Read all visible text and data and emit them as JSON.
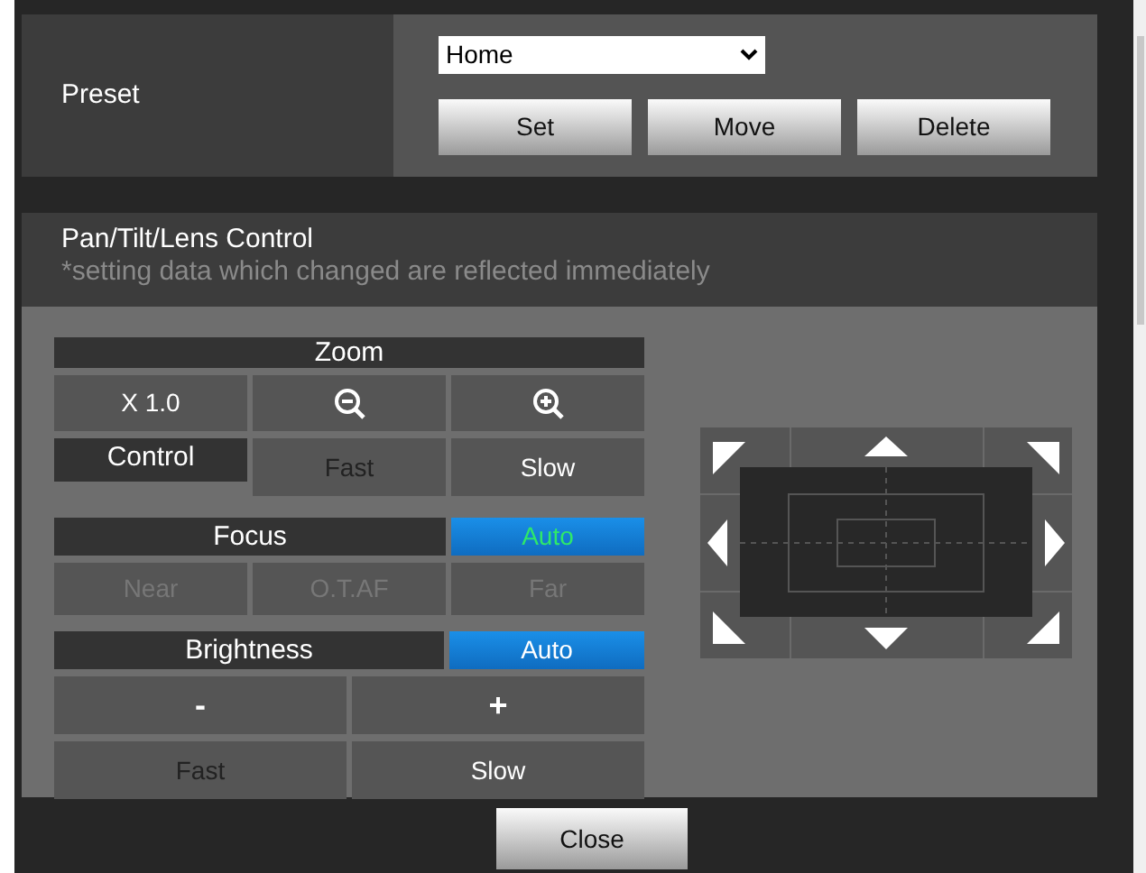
{
  "preset": {
    "label": "Preset",
    "selected_value": "Home",
    "buttons": [
      "Set",
      "Move",
      "Delete"
    ]
  },
  "ptz": {
    "title": "Pan/Tilt/Lens Control",
    "note": "*setting data which changed are reflected immediately",
    "zoom": {
      "heading": "Zoom",
      "value": "X 1.0",
      "control_label": "Control",
      "speeds": [
        {
          "label": "Fast",
          "selected": true
        },
        {
          "label": "Slow",
          "selected": false
        }
      ]
    },
    "focus": {
      "heading": "Focus",
      "auto": {
        "label": "Auto",
        "on": true
      },
      "buttons": [
        {
          "label": "Near",
          "disabled": true
        },
        {
          "label": "O.T.AF",
          "disabled": true
        },
        {
          "label": "Far",
          "disabled": true
        }
      ]
    },
    "brightness": {
      "heading": "Brightness",
      "auto": {
        "label": "Auto",
        "on": false
      },
      "buttons": [
        {
          "label": "-",
          "disabled": false
        },
        {
          "label": "+",
          "disabled": false
        }
      ],
      "speeds": [
        {
          "label": "Fast",
          "selected": true
        },
        {
          "label": "Slow",
          "selected": false
        }
      ]
    }
  },
  "close_button": "Close"
}
